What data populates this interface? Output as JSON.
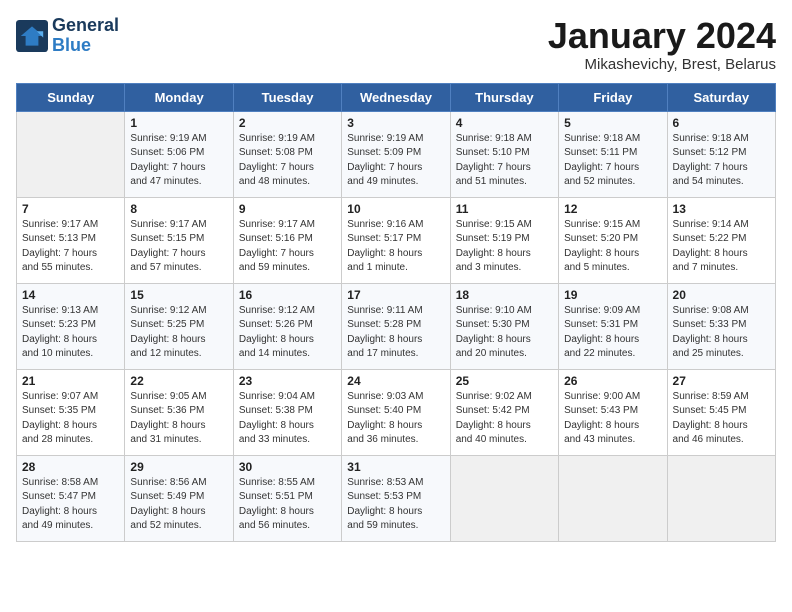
{
  "logo": {
    "line1": "General",
    "line2": "Blue"
  },
  "title": "January 2024",
  "subtitle": "Mikashevichy, Brest, Belarus",
  "days_header": [
    "Sunday",
    "Monday",
    "Tuesday",
    "Wednesday",
    "Thursday",
    "Friday",
    "Saturday"
  ],
  "weeks": [
    [
      {
        "day": "",
        "info": ""
      },
      {
        "day": "1",
        "info": "Sunrise: 9:19 AM\nSunset: 5:06 PM\nDaylight: 7 hours\nand 47 minutes."
      },
      {
        "day": "2",
        "info": "Sunrise: 9:19 AM\nSunset: 5:08 PM\nDaylight: 7 hours\nand 48 minutes."
      },
      {
        "day": "3",
        "info": "Sunrise: 9:19 AM\nSunset: 5:09 PM\nDaylight: 7 hours\nand 49 minutes."
      },
      {
        "day": "4",
        "info": "Sunrise: 9:18 AM\nSunset: 5:10 PM\nDaylight: 7 hours\nand 51 minutes."
      },
      {
        "day": "5",
        "info": "Sunrise: 9:18 AM\nSunset: 5:11 PM\nDaylight: 7 hours\nand 52 minutes."
      },
      {
        "day": "6",
        "info": "Sunrise: 9:18 AM\nSunset: 5:12 PM\nDaylight: 7 hours\nand 54 minutes."
      }
    ],
    [
      {
        "day": "7",
        "info": "Sunrise: 9:17 AM\nSunset: 5:13 PM\nDaylight: 7 hours\nand 55 minutes."
      },
      {
        "day": "8",
        "info": "Sunrise: 9:17 AM\nSunset: 5:15 PM\nDaylight: 7 hours\nand 57 minutes."
      },
      {
        "day": "9",
        "info": "Sunrise: 9:17 AM\nSunset: 5:16 PM\nDaylight: 7 hours\nand 59 minutes."
      },
      {
        "day": "10",
        "info": "Sunrise: 9:16 AM\nSunset: 5:17 PM\nDaylight: 8 hours\nand 1 minute."
      },
      {
        "day": "11",
        "info": "Sunrise: 9:15 AM\nSunset: 5:19 PM\nDaylight: 8 hours\nand 3 minutes."
      },
      {
        "day": "12",
        "info": "Sunrise: 9:15 AM\nSunset: 5:20 PM\nDaylight: 8 hours\nand 5 minutes."
      },
      {
        "day": "13",
        "info": "Sunrise: 9:14 AM\nSunset: 5:22 PM\nDaylight: 8 hours\nand 7 minutes."
      }
    ],
    [
      {
        "day": "14",
        "info": "Sunrise: 9:13 AM\nSunset: 5:23 PM\nDaylight: 8 hours\nand 10 minutes."
      },
      {
        "day": "15",
        "info": "Sunrise: 9:12 AM\nSunset: 5:25 PM\nDaylight: 8 hours\nand 12 minutes."
      },
      {
        "day": "16",
        "info": "Sunrise: 9:12 AM\nSunset: 5:26 PM\nDaylight: 8 hours\nand 14 minutes."
      },
      {
        "day": "17",
        "info": "Sunrise: 9:11 AM\nSunset: 5:28 PM\nDaylight: 8 hours\nand 17 minutes."
      },
      {
        "day": "18",
        "info": "Sunrise: 9:10 AM\nSunset: 5:30 PM\nDaylight: 8 hours\nand 20 minutes."
      },
      {
        "day": "19",
        "info": "Sunrise: 9:09 AM\nSunset: 5:31 PM\nDaylight: 8 hours\nand 22 minutes."
      },
      {
        "day": "20",
        "info": "Sunrise: 9:08 AM\nSunset: 5:33 PM\nDaylight: 8 hours\nand 25 minutes."
      }
    ],
    [
      {
        "day": "21",
        "info": "Sunrise: 9:07 AM\nSunset: 5:35 PM\nDaylight: 8 hours\nand 28 minutes."
      },
      {
        "day": "22",
        "info": "Sunrise: 9:05 AM\nSunset: 5:36 PM\nDaylight: 8 hours\nand 31 minutes."
      },
      {
        "day": "23",
        "info": "Sunrise: 9:04 AM\nSunset: 5:38 PM\nDaylight: 8 hours\nand 33 minutes."
      },
      {
        "day": "24",
        "info": "Sunrise: 9:03 AM\nSunset: 5:40 PM\nDaylight: 8 hours\nand 36 minutes."
      },
      {
        "day": "25",
        "info": "Sunrise: 9:02 AM\nSunset: 5:42 PM\nDaylight: 8 hours\nand 40 minutes."
      },
      {
        "day": "26",
        "info": "Sunrise: 9:00 AM\nSunset: 5:43 PM\nDaylight: 8 hours\nand 43 minutes."
      },
      {
        "day": "27",
        "info": "Sunrise: 8:59 AM\nSunset: 5:45 PM\nDaylight: 8 hours\nand 46 minutes."
      }
    ],
    [
      {
        "day": "28",
        "info": "Sunrise: 8:58 AM\nSunset: 5:47 PM\nDaylight: 8 hours\nand 49 minutes."
      },
      {
        "day": "29",
        "info": "Sunrise: 8:56 AM\nSunset: 5:49 PM\nDaylight: 8 hours\nand 52 minutes."
      },
      {
        "day": "30",
        "info": "Sunrise: 8:55 AM\nSunset: 5:51 PM\nDaylight: 8 hours\nand 56 minutes."
      },
      {
        "day": "31",
        "info": "Sunrise: 8:53 AM\nSunset: 5:53 PM\nDaylight: 8 hours\nand 59 minutes."
      },
      {
        "day": "",
        "info": ""
      },
      {
        "day": "",
        "info": ""
      },
      {
        "day": "",
        "info": ""
      }
    ]
  ]
}
